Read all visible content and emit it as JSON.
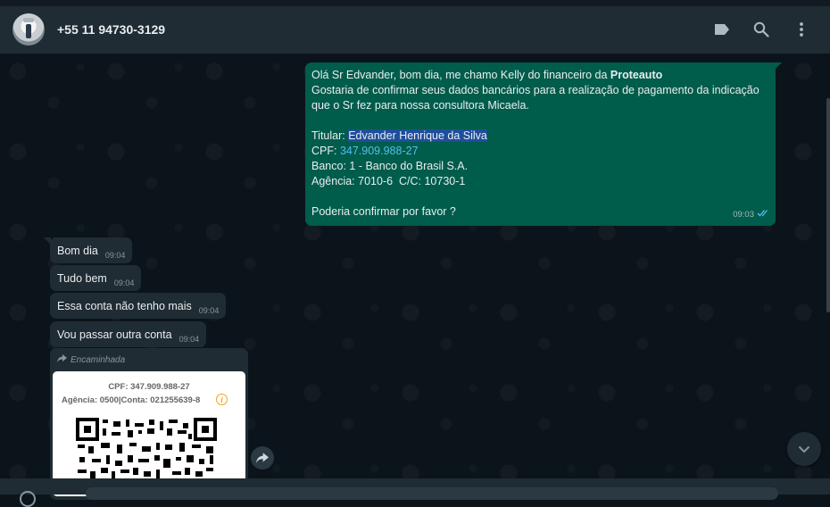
{
  "header": {
    "contact_name": "+55 11 94730-3129",
    "icons": [
      "label-icon",
      "search-icon",
      "menu-icon"
    ]
  },
  "outgoing_message": {
    "line1_prefix": "Olá Sr Edvander, bom dia, me chamo Kelly do financeiro da ",
    "line1_bold": "Proteauto",
    "line2": "Gostaria de confirmar seus dados bancários para a realização de pagamento da indicação",
    "line3": "que o Sr fez para nossa consultora Micaela.",
    "titular_label": "Titular: ",
    "titular_value": "Edvander Henrique da Silva",
    "cpf_label": "CPF: ",
    "cpf_value": "347.909.988-27",
    "banco": "Banco: 1 - Banco do Brasil S.A.",
    "agencia": "Agência: 7010-6  C/C: 10730-1",
    "closing": "Poderia confirmar por favor ?",
    "time": "09:03",
    "status_icon": "double-check-icon"
  },
  "incoming_messages": [
    {
      "text": "Bom dia",
      "time": "09:04"
    },
    {
      "text": "Tudo bem",
      "time": "09:04"
    },
    {
      "text": "Essa conta não tenho mais",
      "time": "09:04"
    },
    {
      "text": "Vou passar outra conta",
      "time": "09:04"
    }
  ],
  "forwarded": {
    "label": "Encaminhada",
    "image_cpf": "CPF: 347.909.988-27",
    "image_agencia": "Agência: 0500|Conta: 021255639-8"
  },
  "colors": {
    "header_bg": "#202c33",
    "chat_bg": "#0b141a",
    "outgoing_bg": "#005c4b",
    "incoming_bg": "#202c33",
    "highlight": "#1f4e9c",
    "link": "#53bdeb"
  }
}
